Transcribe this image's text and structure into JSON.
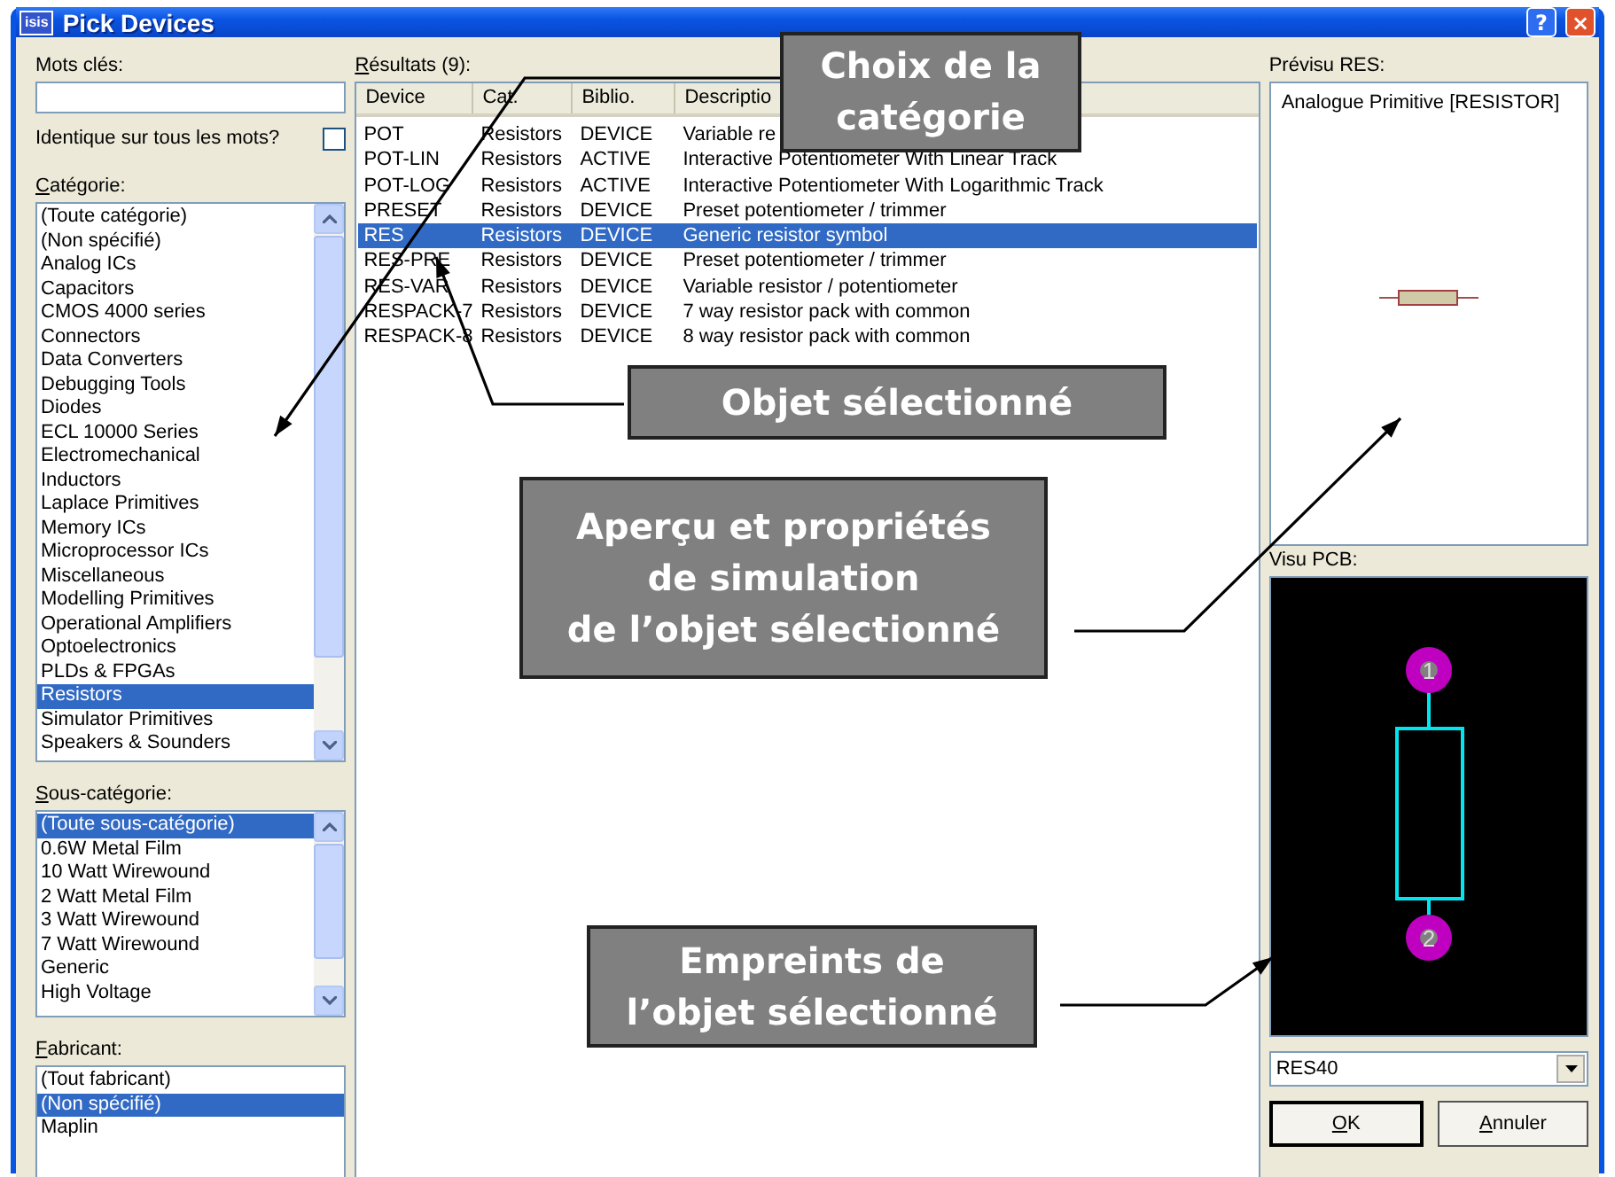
{
  "window": {
    "title": "Pick Devices",
    "logo": "isis",
    "help": "?",
    "close": "×"
  },
  "keywords": {
    "label": "Mots clés:"
  },
  "match_all": {
    "label": "Identique sur tous les mots?",
    "checked": false
  },
  "category": {
    "label": "Catégorie:",
    "items": [
      {
        "label": "(Toute catégorie)",
        "selected": false
      },
      {
        "label": "(Non spécifié)",
        "selected": false
      },
      {
        "label": "Analog ICs",
        "selected": false
      },
      {
        "label": "Capacitors",
        "selected": false
      },
      {
        "label": "CMOS 4000 series",
        "selected": false
      },
      {
        "label": "Connectors",
        "selected": false
      },
      {
        "label": "Data Converters",
        "selected": false
      },
      {
        "label": "Debugging Tools",
        "selected": false
      },
      {
        "label": "Diodes",
        "selected": false
      },
      {
        "label": "ECL 10000 Series",
        "selected": false
      },
      {
        "label": "Electromechanical",
        "selected": false
      },
      {
        "label": "Inductors",
        "selected": false
      },
      {
        "label": "Laplace Primitives",
        "selected": false
      },
      {
        "label": "Memory ICs",
        "selected": false
      },
      {
        "label": "Microprocessor ICs",
        "selected": false
      },
      {
        "label": "Miscellaneous",
        "selected": false
      },
      {
        "label": "Modelling Primitives",
        "selected": false
      },
      {
        "label": "Operational Amplifiers",
        "selected": false
      },
      {
        "label": "Optoelectronics",
        "selected": false
      },
      {
        "label": "PLDs & FPGAs",
        "selected": false
      },
      {
        "label": "Resistors",
        "selected": true
      },
      {
        "label": "Simulator Primitives",
        "selected": false
      },
      {
        "label": "Speakers & Sounders",
        "selected": false
      }
    ]
  },
  "subcategory": {
    "label": "Sous-catégorie:",
    "items": [
      {
        "label": "(Toute sous-catégorie)",
        "selected": true
      },
      {
        "label": "0.6W Metal Film",
        "selected": false
      },
      {
        "label": "10 Watt Wirewound",
        "selected": false
      },
      {
        "label": "2 Watt Metal Film",
        "selected": false
      },
      {
        "label": "3 Watt Wirewound",
        "selected": false
      },
      {
        "label": "7 Watt Wirewound",
        "selected": false
      },
      {
        "label": "Generic",
        "selected": false
      },
      {
        "label": "High Voltage",
        "selected": false
      }
    ]
  },
  "manufacturer": {
    "label": "Fabricant:",
    "items": [
      {
        "label": "(Tout fabricant)",
        "selected": false
      },
      {
        "label": "(Non spécifié)",
        "selected": true
      },
      {
        "label": "Maplin",
        "selected": false
      }
    ]
  },
  "results": {
    "label": "Résultats (9):",
    "columns": [
      "Device",
      "Cat.",
      "Biblio.",
      "Descriptio"
    ],
    "rows": [
      {
        "cells": [
          "POT",
          "Resistors",
          "DEVICE",
          "Variable re"
        ],
        "selected": false
      },
      {
        "cells": [
          "POT-LIN",
          "Resistors",
          "ACTIVE",
          "Interactive Potentiometer With Linear Track"
        ],
        "selected": false
      },
      {
        "cells": [
          "POT-LOG",
          "Resistors",
          "ACTIVE",
          "Interactive Potentiometer With Logarithmic Track"
        ],
        "selected": false
      },
      {
        "cells": [
          "PRESET",
          "Resistors",
          "DEVICE",
          "Preset potentiometer / trimmer"
        ],
        "selected": false
      },
      {
        "cells": [
          "RES",
          "Resistors",
          "DEVICE",
          "Generic resistor symbol"
        ],
        "selected": true
      },
      {
        "cells": [
          "RES-PRE",
          "Resistors",
          "DEVICE",
          "Preset potentiometer / trimmer"
        ],
        "selected": false
      },
      {
        "cells": [
          "RES-VAR",
          "Resistors",
          "DEVICE",
          "Variable resistor / potentiometer"
        ],
        "selected": false
      },
      {
        "cells": [
          "RESPACK-7",
          "Resistors",
          "DEVICE",
          "7 way resistor pack with common"
        ],
        "selected": false
      },
      {
        "cells": [
          "RESPACK-8",
          "Resistors",
          "DEVICE",
          "8 way resistor pack with common"
        ],
        "selected": false
      }
    ]
  },
  "preview": {
    "label": "Prévisu RES:",
    "text": "Analogue Primitive [RESISTOR]"
  },
  "pcb": {
    "label": "Visu PCB:",
    "pads": [
      "1",
      "2"
    ]
  },
  "package": {
    "value": "RES40"
  },
  "buttons": [
    {
      "label": "OK",
      "default": true
    },
    {
      "label": "Annuler",
      "default": false
    }
  ],
  "callouts": [
    {
      "text": "Choix de la\ncatégorie"
    },
    {
      "text": "Objet sélectionné"
    },
    {
      "text": "Aperçu  et propriétés\nde simulation\nde l’objet sélectionné"
    },
    {
      "text": "Empreints de\nl’objet sélectionné"
    }
  ]
}
